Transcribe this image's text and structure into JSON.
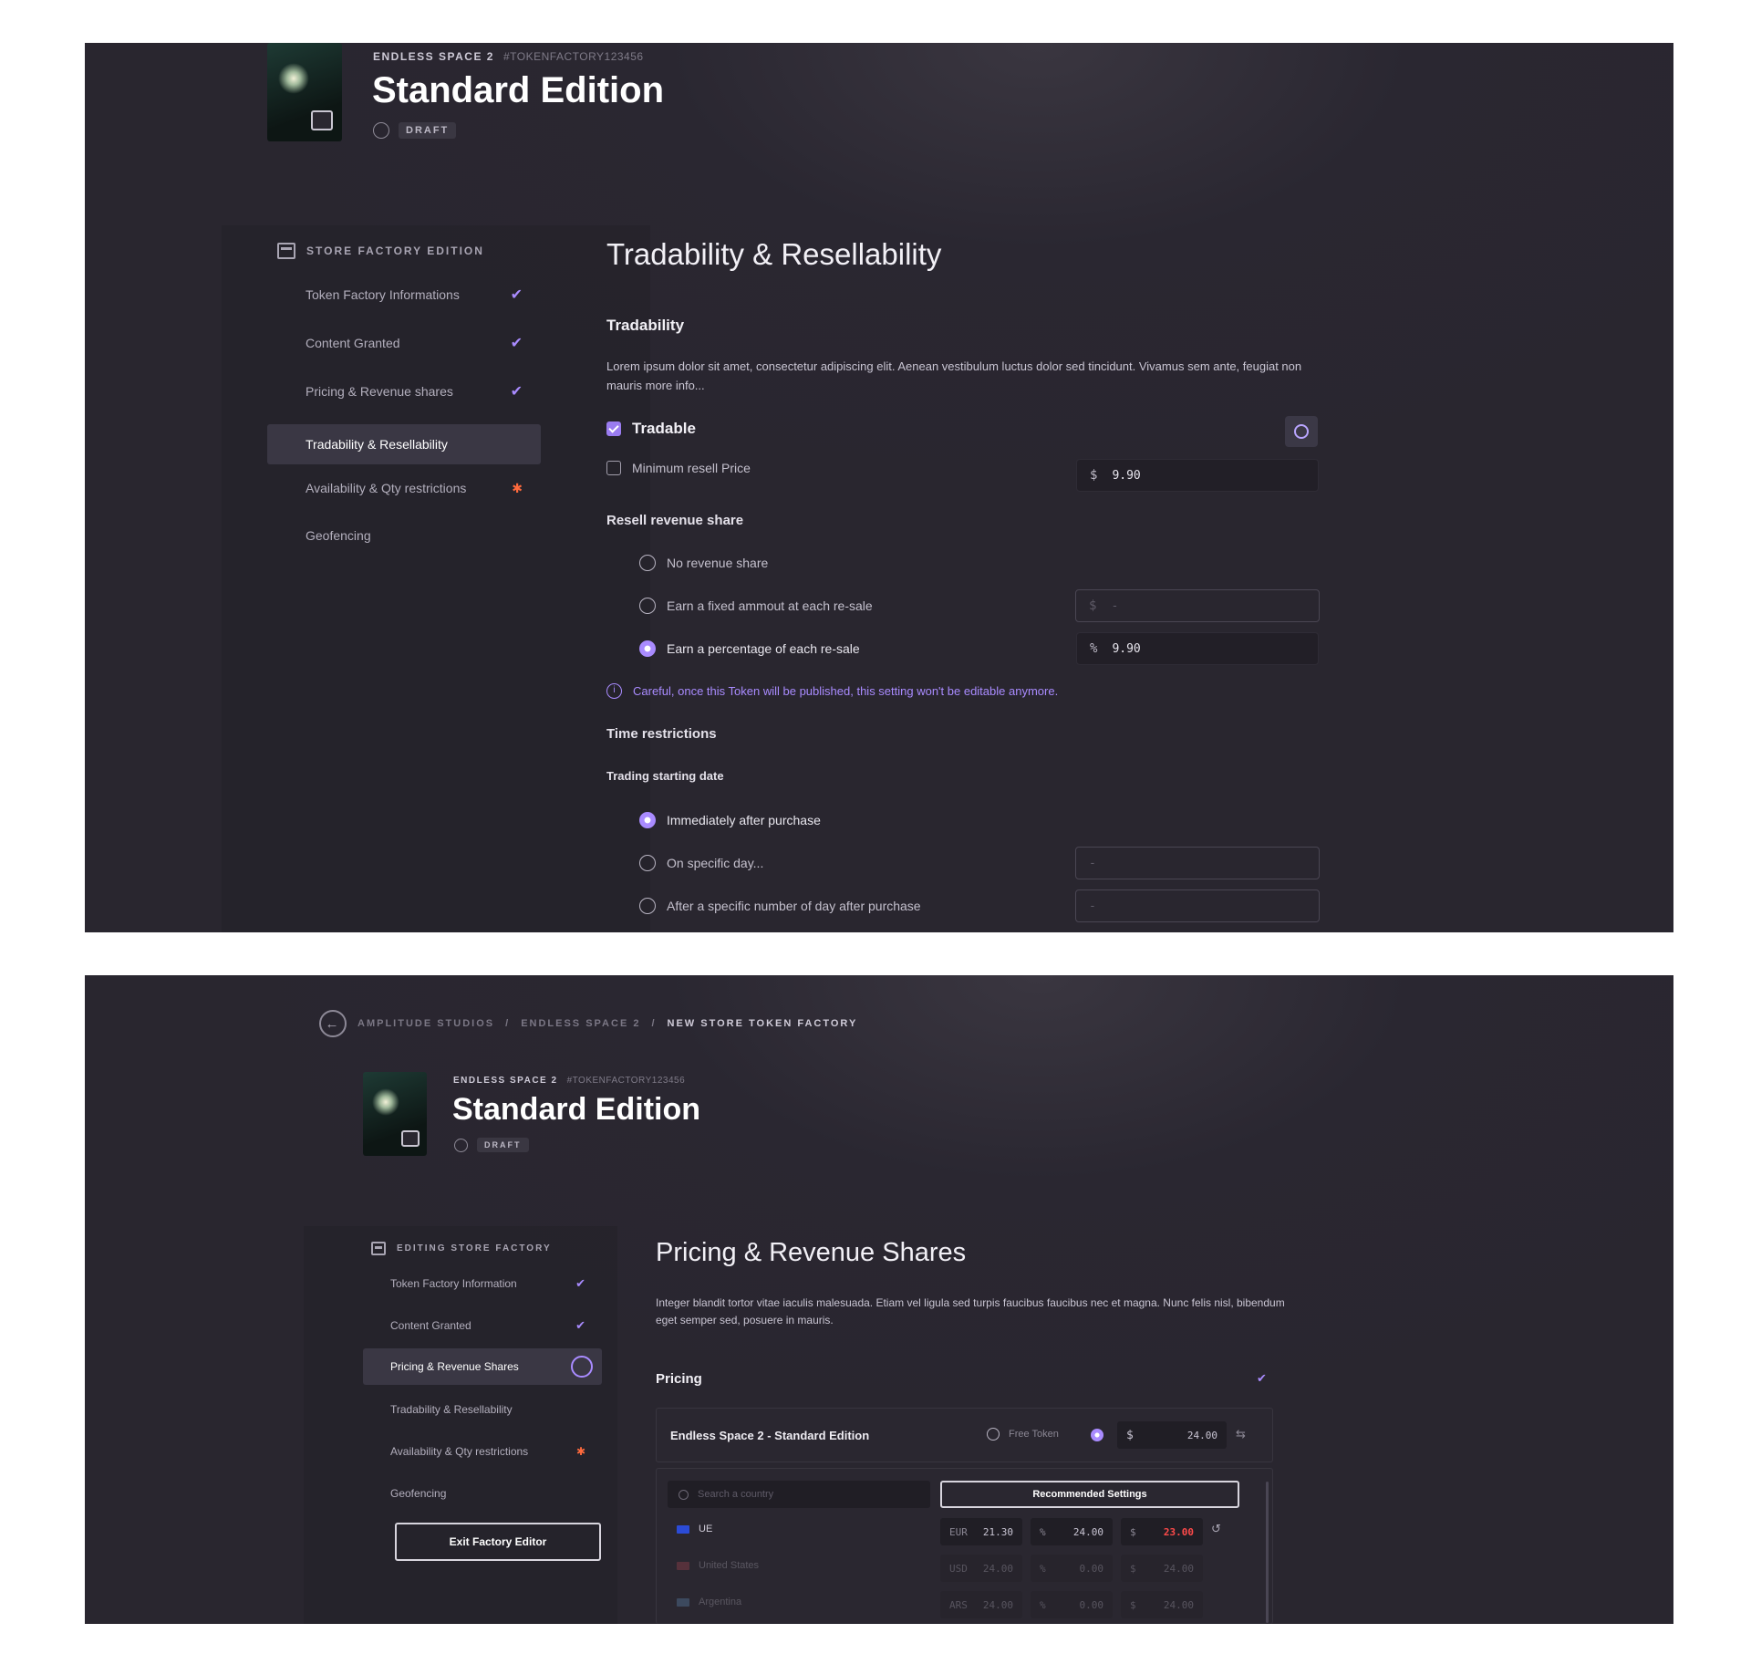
{
  "colors": {
    "accent": "#a98bff",
    "warning": "#ff6a3d",
    "error": "#ff4a4a",
    "background": "#29262f"
  },
  "game": {
    "franchise": "ENDLESS SPACE 2",
    "token_id": "#TOKENFACTORY123456",
    "edition": "Standard Edition",
    "status": "DRAFT"
  },
  "screen1": {
    "sidebar": {
      "header": "STORE FACTORY EDITION",
      "items": [
        {
          "label": "Token Factory Informations",
          "state": "done"
        },
        {
          "label": "Content Granted",
          "state": "done"
        },
        {
          "label": "Pricing & Revenue shares",
          "state": "done"
        },
        {
          "label": "Tradability & Resellability",
          "state": "active"
        },
        {
          "label": "Availability & Qty restrictions",
          "state": "required"
        },
        {
          "label": "Geofencing",
          "state": "none"
        }
      ]
    },
    "title": "Tradability & Resellability",
    "tradability": {
      "heading": "Tradability",
      "description": "Lorem ipsum dolor sit amet, consectetur adipiscing elit. Aenean vestibulum luctus dolor sed tincidunt. Vivamus sem ante, feugiat non mauris more info...",
      "tradable_label": "Tradable",
      "tradable_checked": true,
      "min_resell_label": "Minimum resell Price",
      "min_resell_checked": false,
      "min_resell_unit": "$",
      "min_resell_value": "9.90"
    },
    "resell": {
      "heading": "Resell revenue share",
      "options": [
        {
          "label": "No revenue share",
          "selected": false
        },
        {
          "label": "Earn a fixed ammout at each re-sale",
          "selected": false,
          "unit": "$",
          "placeholder": "-"
        },
        {
          "label": "Earn a percentage of each re-sale",
          "selected": true,
          "unit": "%",
          "value": "9.90"
        }
      ],
      "warning": "Careful, once this Token will be published, this setting won't be editable anymore."
    },
    "time": {
      "heading": "Time restrictions",
      "sub": "Trading starting date",
      "options": [
        {
          "label": "Immediately after purchase",
          "selected": true
        },
        {
          "label": "On specific day...",
          "selected": false,
          "placeholder": "-"
        },
        {
          "label": "After a specific number of day after purchase",
          "selected": false,
          "placeholder": "-"
        }
      ]
    }
  },
  "screen2": {
    "breadcrumb": [
      "AMPLITUDE STUDIOS",
      "ENDLESS SPACE 2",
      "NEW STORE TOKEN FACTORY"
    ],
    "sidebar": {
      "header": "EDITING STORE FACTORY",
      "items": [
        {
          "label": "Token Factory Information",
          "state": "done"
        },
        {
          "label": "Content Granted",
          "state": "done"
        },
        {
          "label": "Pricing & Revenue Shares",
          "state": "active"
        },
        {
          "label": "Tradability & Resellability",
          "state": "none"
        },
        {
          "label": "Availability & Qty restrictions",
          "state": "required"
        },
        {
          "label": "Geofencing",
          "state": "none"
        }
      ],
      "exit_label": "Exit Factory Editor"
    },
    "title": "Pricing & Revenue Shares",
    "description": "Integer blandit tortor vitae iaculis malesuada. Etiam vel ligula sed turpis faucibus faucibus nec et magna. Nunc felis nisl, bibendum eget semper sed, posuere in mauris.",
    "pricing": {
      "heading": "Pricing",
      "product": "Endless Space 2 - Standard Edition",
      "free_token_label": "Free Token",
      "price_unit": "$",
      "price_value": "24.00",
      "search_placeholder": "Search a country",
      "recommended_label": "Recommended Settings",
      "rows": [
        {
          "country": "UE",
          "currency": "EUR",
          "local": "21.30",
          "pct": "24.00",
          "usd": "23.00",
          "flag": "#2b4bd6"
        },
        {
          "country": "United States",
          "currency": "USD",
          "local": "24.00",
          "pct": "0.00",
          "usd": "24.00",
          "flag": "#c84a5a"
        },
        {
          "country": "Argentina",
          "currency": "ARS",
          "local": "24.00",
          "pct": "0.00",
          "usd": "24.00",
          "flag": "#6aa0d8"
        }
      ],
      "pct_unit": "%",
      "usd_unit": "$"
    }
  }
}
